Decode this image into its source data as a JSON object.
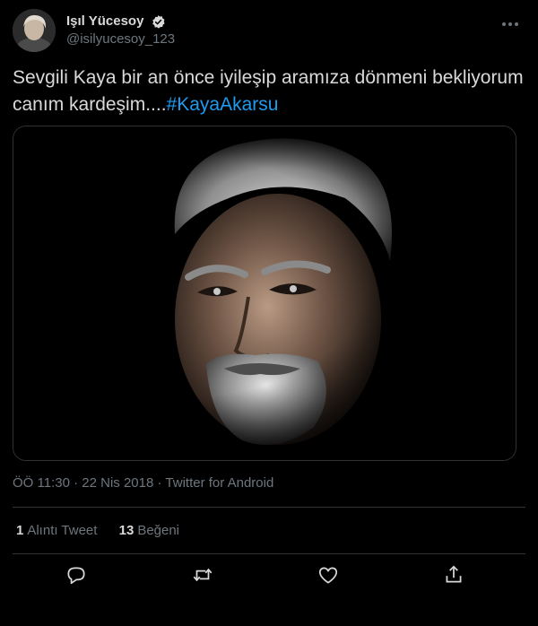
{
  "author": {
    "display_name": "Işıl Yücesoy",
    "handle": "@isilyucesoy_123",
    "verified_icon": "verified-badge-icon"
  },
  "tweet": {
    "text": "Sevgili Kaya bir an önce iyileşip aramıza dönmeni bekliyorum canım kardeşim....",
    "hashtag": "#KayaAkarsu"
  },
  "meta": {
    "time": "ÖÖ 11:30",
    "separator1": " · ",
    "date": "22 Nis 2018",
    "separator2": " · ",
    "source": "Twitter for Android"
  },
  "stats": {
    "quote_count": "1",
    "quote_label": "Alıntı Tweet",
    "like_count": "13",
    "like_label": "Beğeni"
  },
  "actions": [
    {
      "icon": "reply-icon"
    },
    {
      "icon": "retweet-icon"
    },
    {
      "icon": "like-heart-icon"
    },
    {
      "icon": "share-icon"
    }
  ],
  "colors": {
    "background": "#000000",
    "text": "#d9d9d9",
    "secondary": "#6e767d",
    "accent": "#1d9bf0",
    "border": "#2f3336"
  }
}
